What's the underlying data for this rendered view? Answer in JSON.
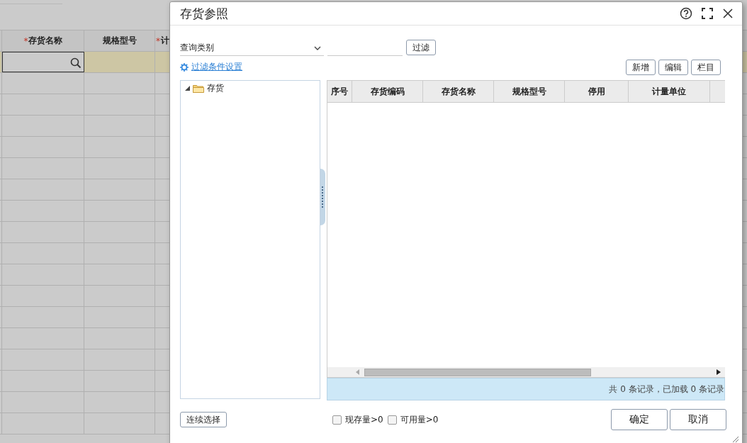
{
  "background_grid": {
    "columns": [
      {
        "label": "存货名称",
        "required_mark": "*"
      },
      {
        "label": "规格型号"
      },
      {
        "label": "计",
        "required_mark": "*"
      }
    ]
  },
  "dialog": {
    "title": "存货参照",
    "query_select": {
      "value": "查询类别"
    },
    "filter_button": "过滤",
    "filter_settings_link": "过滤条件设置",
    "toolbar_buttons": [
      "新增",
      "编辑",
      "栏目"
    ],
    "tree": [
      {
        "label": "存货",
        "expanded": true
      }
    ],
    "table": {
      "columns": [
        "序号",
        "存货编码",
        "存货名称",
        "规格型号",
        "停用",
        "计量单位"
      ]
    },
    "status": "共 0 条记录，已加载 0 条记录",
    "continuous_select_button": "连续选择",
    "options": [
      {
        "label": "现存量>0",
        "checked": false
      },
      {
        "label": "可用量>0",
        "checked": false
      }
    ],
    "buttons": [
      "确定",
      "取消"
    ]
  }
}
